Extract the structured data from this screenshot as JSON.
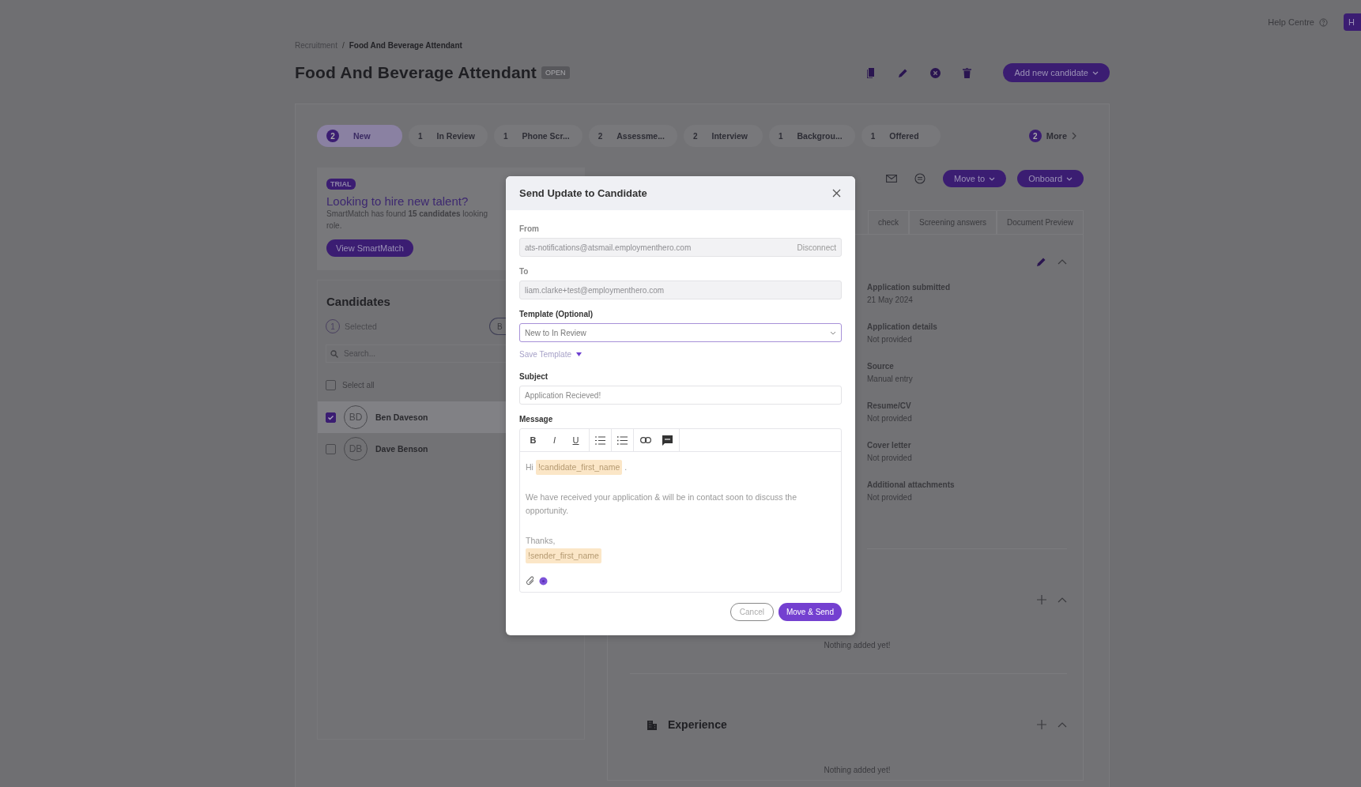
{
  "top_bar": {
    "help_link": "Help Centre",
    "button": "H"
  },
  "breadcrumb": {
    "separator": "/",
    "items": [
      {
        "label": "Recruitment",
        "current": false
      },
      {
        "label": "Food And Beverage Attendant",
        "current": true
      }
    ]
  },
  "job": {
    "title": "Food And Beverage Attendant",
    "status": "OPEN",
    "add_button": "Add new candidate"
  },
  "stages": [
    {
      "count": "2",
      "label": "New",
      "selected": true
    },
    {
      "count": "1",
      "label": "In Review",
      "selected": false
    },
    {
      "count": "1",
      "label": "Phone Scr...",
      "selected": false
    },
    {
      "count": "2",
      "label": "Assessme...",
      "selected": false
    },
    {
      "count": "2",
      "label": "Interview",
      "selected": false
    },
    {
      "count": "1",
      "label": "Backgrou...",
      "selected": false
    },
    {
      "count": "1",
      "label": "Offered",
      "selected": false
    }
  ],
  "more": {
    "count": "2",
    "label": "More"
  },
  "promo": {
    "badge": "TRIAL",
    "title": "Looking to hire new talent?",
    "lines": [
      "SmartMatch has found **15 candidates** looking",
      "role."
    ],
    "button": "View SmartMatch"
  },
  "candidates": {
    "title": "Candidates",
    "selected_count": "1",
    "selected_label": "Selected",
    "bulk_button": "B",
    "search_placeholder": "Search...",
    "select_all": {
      "label": "Select all",
      "checked": false
    },
    "rows": [
      {
        "initials": "BD",
        "name": "Ben Daveson",
        "checked": true,
        "selected": true
      },
      {
        "initials": "DB",
        "name": "Dave Benson",
        "checked": false,
        "selected": false
      }
    ]
  },
  "profile": {
    "move_button": "Move to",
    "onboard_button": "Onboard",
    "tabs": [
      "check",
      "Screening answers",
      "Document Preview"
    ],
    "details": [
      {
        "label": "Application submitted",
        "value": "21 May 2024"
      },
      {
        "label": "Application details",
        "value": "Not provided"
      },
      {
        "label": "Source",
        "value": "Manual entry"
      },
      {
        "label": "Resume/CV",
        "value": "Not provided"
      },
      {
        "label": "Cover letter",
        "value": "Not provided"
      },
      {
        "label": "Additional attachments",
        "value": "Not provided"
      }
    ],
    "sections": [
      {
        "empty_text": "Nothing added yet!"
      },
      {
        "title": "Experience",
        "empty_text": "Nothing added yet!"
      }
    ]
  },
  "dialog": {
    "title": "Send Update to Candidate",
    "from": {
      "label": "From",
      "value": "ats-notifications@atsmail.employmenthero.com",
      "action": "Disconnect"
    },
    "to": {
      "label": "To",
      "value": "liam.clarke+test@employmenthero.com"
    },
    "template": {
      "label": "Template (Optional)",
      "value": "New to In Review"
    },
    "save_template": "Save Template",
    "subject": {
      "label": "Subject",
      "value": "Application Recieved!"
    },
    "message": {
      "label": "Message",
      "format_buttons": [
        {
          "label": "B",
          "kind": "bold"
        },
        {
          "label": "I",
          "kind": "italic"
        },
        {
          "label": "U",
          "kind": "underline"
        }
      ],
      "paragraphs": [
        {
          "lines": [
            [
              {
                "kind": "text",
                "text": "Hi"
              },
              {
                "kind": "tag",
                "text": "!candidate_first_name"
              },
              {
                "kind": "text",
                "text": "."
              }
            ]
          ]
        },
        {
          "lines": [
            [
              {
                "kind": "text",
                "text": "We have received your application & will be in contact soon to discuss the opportunity."
              }
            ]
          ]
        },
        {
          "lines": [
            [
              {
                "kind": "text",
                "text": "Thanks,"
              }
            ],
            [
              {
                "kind": "tag",
                "text": "!sender_first_name"
              }
            ]
          ]
        }
      ]
    },
    "buttons": [
      {
        "label": "Cancel",
        "kind": "secondary"
      },
      {
        "label": "Move & Send",
        "kind": "primary"
      }
    ]
  }
}
